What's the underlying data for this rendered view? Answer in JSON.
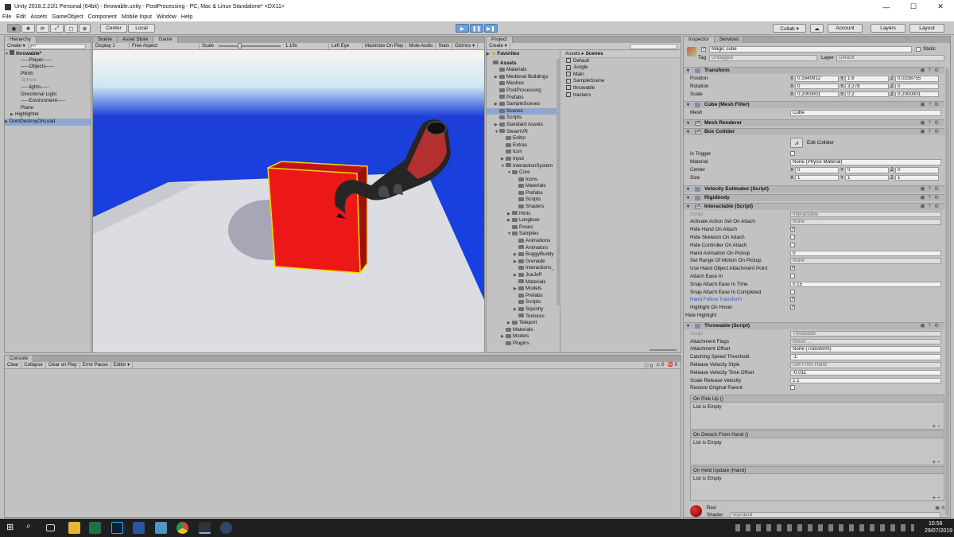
{
  "window": {
    "title": "Unity 2018.2.21f1 Personal (64bit) - throwable.unity - PostProcessing - PC, Mac & Linux Standalone* <DX11>",
    "controls": [
      "—",
      "☐",
      "✕"
    ]
  },
  "menu": [
    "File",
    "Edit",
    "Assets",
    "GameObject",
    "Component",
    "Mobile Input",
    "Window",
    "Help"
  ],
  "toolbar": {
    "center": "Center",
    "local": "Local",
    "collab": "Collab ▾",
    "account": "Account",
    "layers": "Layers",
    "layout": "Layout"
  },
  "hierarchy": {
    "tab": "Hierarchy",
    "create": "Create ▾",
    "search_placeholder": "All",
    "scene": "throwable*",
    "items": [
      {
        "label": "-----Player-----",
        "indent": 2,
        "sel": false
      },
      {
        "label": "-----Objects-----",
        "indent": 2,
        "sel": false
      },
      {
        "label": "Plinth",
        "indent": 2,
        "sel": false
      },
      {
        "label": "Sphere",
        "indent": 2,
        "sel": false,
        "gray": true
      },
      {
        "label": "-----lights-----",
        "indent": 2,
        "sel": false
      },
      {
        "label": "Directional Light",
        "indent": 2,
        "sel": false
      },
      {
        "label": "-----Environment-----",
        "indent": 2,
        "sel": false
      },
      {
        "label": "Plane",
        "indent": 2,
        "sel": false
      },
      {
        "label": "Highlighter",
        "indent": 1,
        "arrow": true,
        "sel": false
      },
      {
        "label": "DontDestroyOnLoad",
        "indent": 0,
        "arrow": true,
        "sel": true
      }
    ]
  },
  "scene_tabs": [
    "Scene",
    "Asset Store",
    "Game"
  ],
  "game_bar": {
    "display": "Display 1",
    "aspect": "Free Aspect",
    "scale_label": "Scale",
    "scale_value": "1.19x",
    "left_eye": "Left Eye",
    "maximize": "Maximize On Play",
    "mute": "Mute Audio",
    "stats": "Stats",
    "gizmos": "Gizmos ▾"
  },
  "project": {
    "tab": "Project",
    "create": "Create ▾",
    "favorites": "Favorites",
    "breadcrumb_root": "Assets",
    "breadcrumb_leaf": "Scenes",
    "tree": [
      {
        "label": "Assets",
        "d": 0,
        "b": true
      },
      {
        "label": "Materials",
        "d": 1
      },
      {
        "label": "Medieval Buildings",
        "d": 1,
        "a": true
      },
      {
        "label": "Meshes",
        "d": 1
      },
      {
        "label": "PostProcessing",
        "d": 1
      },
      {
        "label": "Prefabs",
        "d": 1
      },
      {
        "label": "SampleScenes",
        "d": 1,
        "a": true
      },
      {
        "label": "Scenes",
        "d": 1,
        "sel": true
      },
      {
        "label": "Scripts",
        "d": 1
      },
      {
        "label": "Standard Assets",
        "d": 1,
        "a": true
      },
      {
        "label": "SteamVR",
        "d": 1,
        "o": true
      },
      {
        "label": "Editor",
        "d": 2
      },
      {
        "label": "Extras",
        "d": 2
      },
      {
        "label": "Icon",
        "d": 2
      },
      {
        "label": "Input",
        "d": 2,
        "a": true
      },
      {
        "label": "InteractionSystem",
        "d": 2,
        "o": true
      },
      {
        "label": "Core",
        "d": 3,
        "o": true
      },
      {
        "label": "Icons",
        "d": 4
      },
      {
        "label": "Materials",
        "d": 4
      },
      {
        "label": "Prefabs",
        "d": 4
      },
      {
        "label": "Scripts",
        "d": 4
      },
      {
        "label": "Shaders",
        "d": 4
      },
      {
        "label": "Hints",
        "d": 3,
        "a": true
      },
      {
        "label": "Longbow",
        "d": 3,
        "a": true
      },
      {
        "label": "Poses",
        "d": 3
      },
      {
        "label": "Samples",
        "d": 3,
        "o": true
      },
      {
        "label": "Animations",
        "d": 4
      },
      {
        "label": "Animators",
        "d": 4
      },
      {
        "label": "BuggyBuddy",
        "d": 4,
        "a": true
      },
      {
        "label": "Grenade",
        "d": 4,
        "a": true
      },
      {
        "label": "Interactions_",
        "d": 4
      },
      {
        "label": "JoeJeff",
        "d": 4,
        "a": true
      },
      {
        "label": "Materials",
        "d": 4
      },
      {
        "label": "Models",
        "d": 4,
        "a": true
      },
      {
        "label": "Prefabs",
        "d": 4
      },
      {
        "label": "Scripts",
        "d": 4
      },
      {
        "label": "Squishy",
        "d": 4,
        "a": true
      },
      {
        "label": "Textures",
        "d": 4
      },
      {
        "label": "Teleport",
        "d": 3,
        "a": true
      },
      {
        "label": "Materials",
        "d": 2
      },
      {
        "label": "Models",
        "d": 2,
        "a": true
      },
      {
        "label": "Plugins",
        "d": 2
      }
    ],
    "files": [
      "Default",
      "Jungle",
      "Main",
      "SampleScene",
      "throwable",
      "trackers"
    ]
  },
  "inspector": {
    "tabs": [
      "Inspector",
      "Services"
    ],
    "name": "Magic cube",
    "static": "Static",
    "tag_label": "Tag",
    "tag": "Untagged",
    "layer_label": "Layer",
    "layer": "Default",
    "transform": {
      "title": "Transform",
      "rows": [
        {
          "l": "Position",
          "x": "0.1640912",
          "y": "1.6",
          "z": "0.0238755"
        },
        {
          "l": "Rotation",
          "x": "0",
          "y": "3.278",
          "z": "0"
        },
        {
          "l": "Scale",
          "x": "0.2000001",
          "y": "0.2",
          "z": "0.2000001"
        }
      ]
    },
    "mesh_filter": {
      "title": "Cube (Mesh Filter)",
      "mesh_label": "Mesh",
      "mesh": "Cube"
    },
    "mesh_renderer": "Mesh Renderer",
    "box_collider": {
      "title": "Box Collider",
      "edit": "Edit Collider",
      "is_trigger": "Is Trigger",
      "material_label": "Material",
      "material": "None (Physic Material)",
      "center_label": "Center",
      "center": [
        "0",
        "0",
        "0"
      ],
      "size_label": "Size",
      "size": [
        "1",
        "1",
        "1"
      ]
    },
    "velocity": "Velocity Estimator (Script)",
    "rigidbody": "Rigidbody",
    "interactable": {
      "title": "Interactable (Script)",
      "rows": [
        {
          "l": "Script",
          "v": "Interactable",
          "t": "drop",
          "gray": true
        },
        {
          "l": "Activate Action Set On Attach",
          "v": "None",
          "t": "drop"
        },
        {
          "l": "Hide Hand On Attach",
          "t": "chk",
          "c": true
        },
        {
          "l": "Hide Skeleton On Attach",
          "t": "chk",
          "c": false
        },
        {
          "l": "Hide Controller On Attach",
          "t": "chk",
          "c": false
        },
        {
          "l": "Hand Animation On Pickup",
          "v": "0",
          "t": "txt"
        },
        {
          "l": "Set Range Of Motion On Pickup",
          "v": "None",
          "t": "drop"
        },
        {
          "l": "Use Hand Object Attachment Point",
          "t": "chk",
          "c": true
        },
        {
          "l": "Attach Ease In",
          "t": "chk",
          "c": false
        },
        {
          "l": "Snap Attach Ease In Time",
          "v": "0.15",
          "t": "txt"
        },
        {
          "l": "Snap Attach Ease In Completed",
          "t": "chk",
          "c": false
        },
        {
          "l": "Hand Follow Transform",
          "t": "chk",
          "c": true,
          "blue": true
        },
        {
          "l": "Highlight On Hover",
          "t": "chk",
          "c": true
        },
        {
          "l": "Hide Highlight",
          "t": "fold"
        }
      ]
    },
    "throwable": {
      "title": "Throwable (Script)",
      "rows": [
        {
          "l": "Script",
          "v": "Throwable",
          "t": "drop",
          "gray": true
        },
        {
          "l": "Attachment Flags",
          "v": "Mixed ...",
          "t": "drop"
        },
        {
          "l": "Attachment Offset",
          "v": "None (Transform)",
          "t": "txt"
        },
        {
          "l": "Catching Speed Threshold",
          "v": "-1",
          "t": "txt"
        },
        {
          "l": "Release Velocity Style",
          "v": "Get From Hand",
          "t": "drop"
        },
        {
          "l": "Release Velocity Time Offset",
          "v": "-0.011",
          "t": "txt"
        },
        {
          "l": "Scale Release Velocity",
          "v": "1.1",
          "t": "txt"
        },
        {
          "l": "Restore Original Parent",
          "t": "chk",
          "c": false
        }
      ]
    },
    "events": [
      {
        "h": "On Pick Up ()",
        "b": "List is Empty"
      },
      {
        "h": "On Detach From Hand ()",
        "b": "List is Empty"
      },
      {
        "h": "On Held Update (Hand)",
        "b": "List is Empty"
      }
    ],
    "material": {
      "name": "Red",
      "shader_label": "Shader",
      "shader": "Standard"
    }
  },
  "console": {
    "tab": "Console",
    "buttons": [
      "Clear",
      "Collapse",
      "Clear on Play",
      "Error Pause",
      "Editor ▾"
    ],
    "counts": [
      "0",
      "0",
      "0"
    ]
  },
  "taskbar": {
    "time": "10:56",
    "date": "29/07/2019"
  }
}
